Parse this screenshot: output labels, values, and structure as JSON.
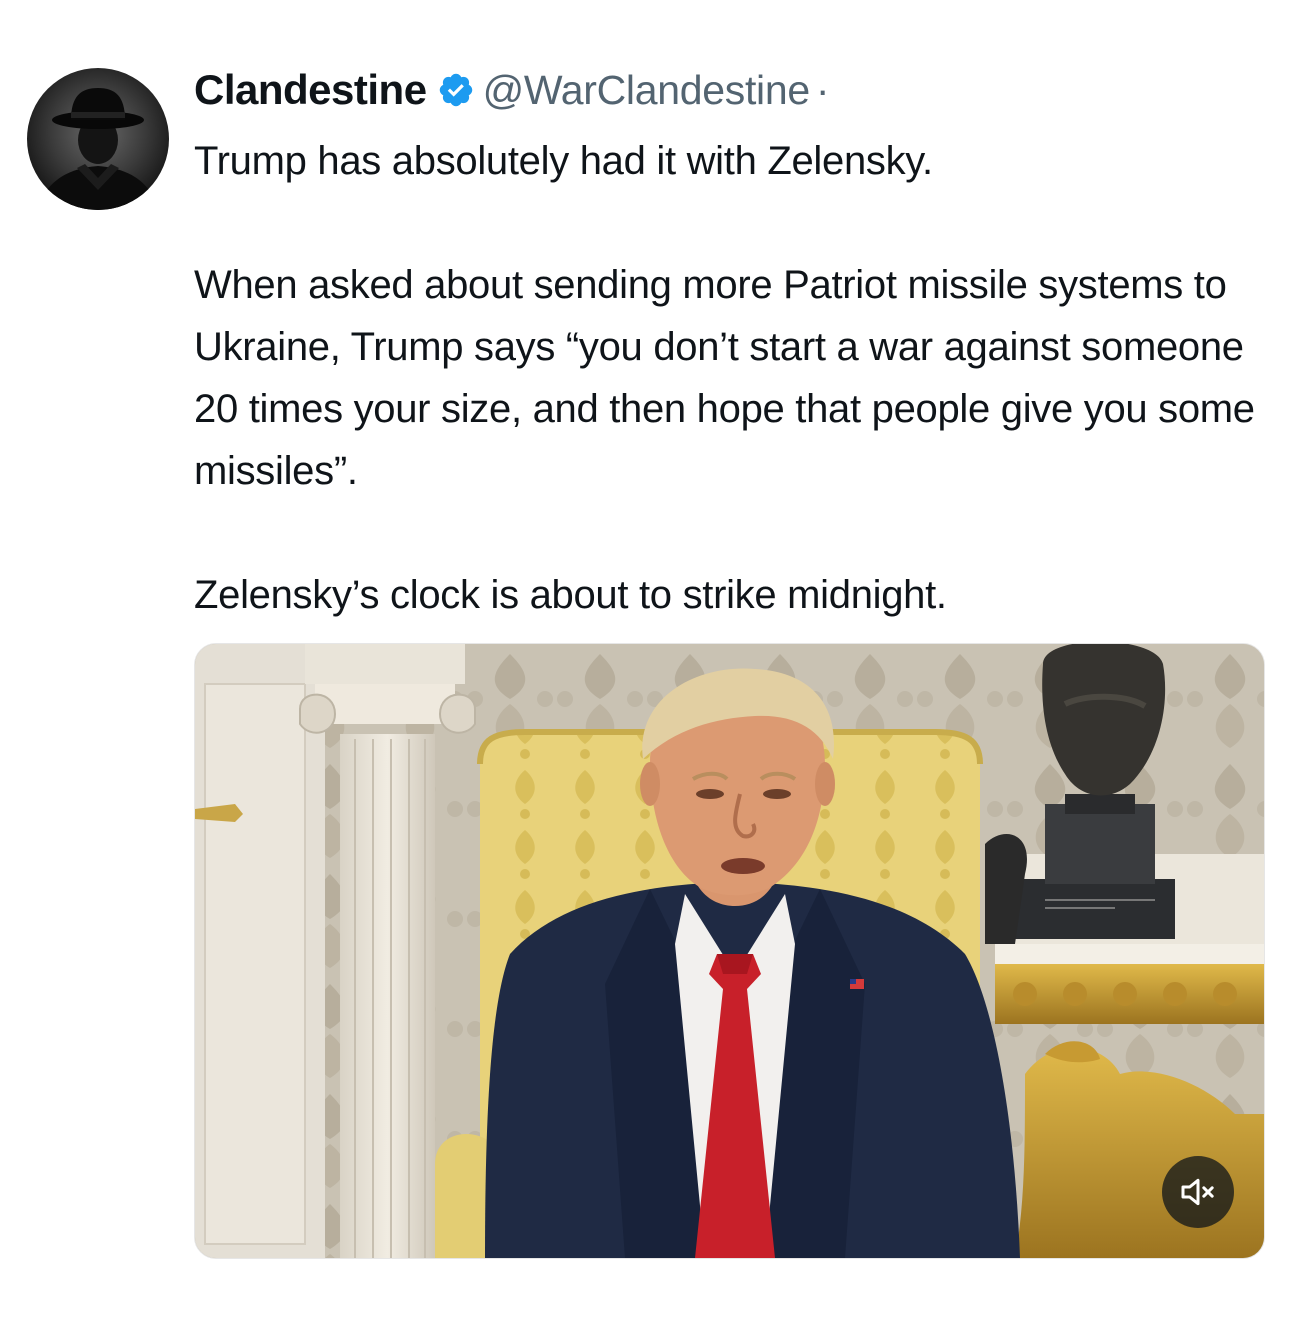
{
  "tweet": {
    "author": {
      "display_name": "Clandestine",
      "handle": "@WarClandestine",
      "separator": "·",
      "verified": true,
      "avatar_icon": "avatar-silhouette-fedora"
    },
    "text": {
      "line1": "Trump has absolutely had it with Zelensky.",
      "para2": "When asked about sending more Patriot missile systems to Ukraine, Trump says “you don’t start a war against someone 20 times your size, and then hope that people give you some missiles”.",
      "para3": "Zelensky’s clock is about to strike midnight."
    },
    "media": {
      "type": "video",
      "mute_icon": "speaker-muted-icon"
    }
  },
  "colors": {
    "text_primary": "#0f1419",
    "text_secondary": "#536471",
    "verified_blue": "#1d9bf0",
    "suit_navy": "#1f2a44",
    "tie_red": "#c8202a"
  }
}
